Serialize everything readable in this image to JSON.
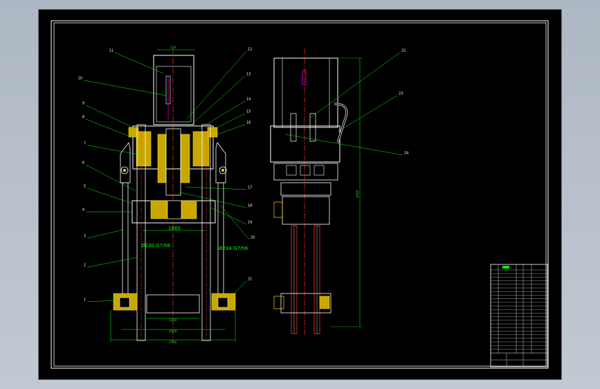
{
  "window": {
    "background": "#b7c0cb"
  },
  "drawing": {
    "front_labels": [
      "11",
      "10",
      "9",
      "8",
      "7",
      "6",
      "5",
      "4",
      "3",
      "2",
      "1",
      "12",
      "13",
      "14",
      "15",
      "16",
      "17",
      "18",
      "19",
      "20",
      "21"
    ],
    "side_labels": [
      "22",
      "23",
      "24"
    ],
    "dimensions": {
      "top_width": "120",
      "frame_width": "1660",
      "left_rod_fit": "Ø230 G7/h6",
      "right_rod_fit": "Ø234 G7/h6",
      "side_height": "4000",
      "base_width_1": "1250",
      "base_width_2": "2310",
      "base_width_3": "2500"
    }
  },
  "colors": {
    "sheet": "#000000",
    "outline": "#ffffff",
    "dimension": "#00ff00",
    "section": "#ffd700",
    "centerline": "#ff3030",
    "accent": "#ff00ff"
  }
}
